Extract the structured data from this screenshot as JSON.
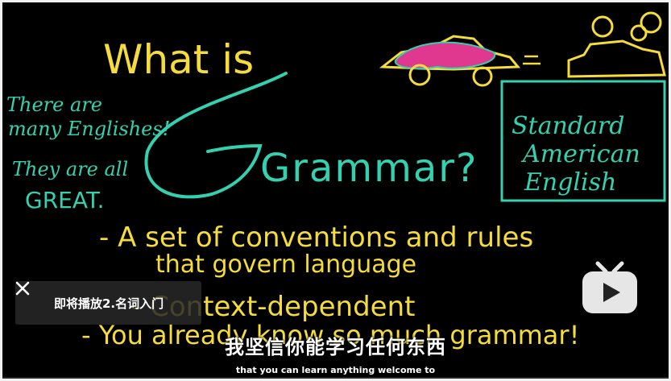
{
  "board": {
    "title_line": "What is",
    "main_word": "Grammar?",
    "side_note": [
      "There are",
      "many Englishes!",
      "They are all",
      "GREAT."
    ],
    "box_text": [
      "Standard",
      "American",
      "English"
    ],
    "bullets": [
      "- A set of conventions and rules",
      "that govern language",
      "- Context-dependent",
      "- You already know so much grammar!"
    ],
    "colors": {
      "yellow": "#f5dc3a",
      "teal": "#33d1b0",
      "magenta": "#e0388f"
    }
  },
  "up_next": {
    "close_icon": "close-icon",
    "label": "即将播放2.名词入门"
  },
  "subtitles": {
    "chinese": "我坚信你能学习任何东西",
    "english": "that you can learn anything welcome to"
  },
  "player": {
    "play_icon": "play-icon"
  }
}
